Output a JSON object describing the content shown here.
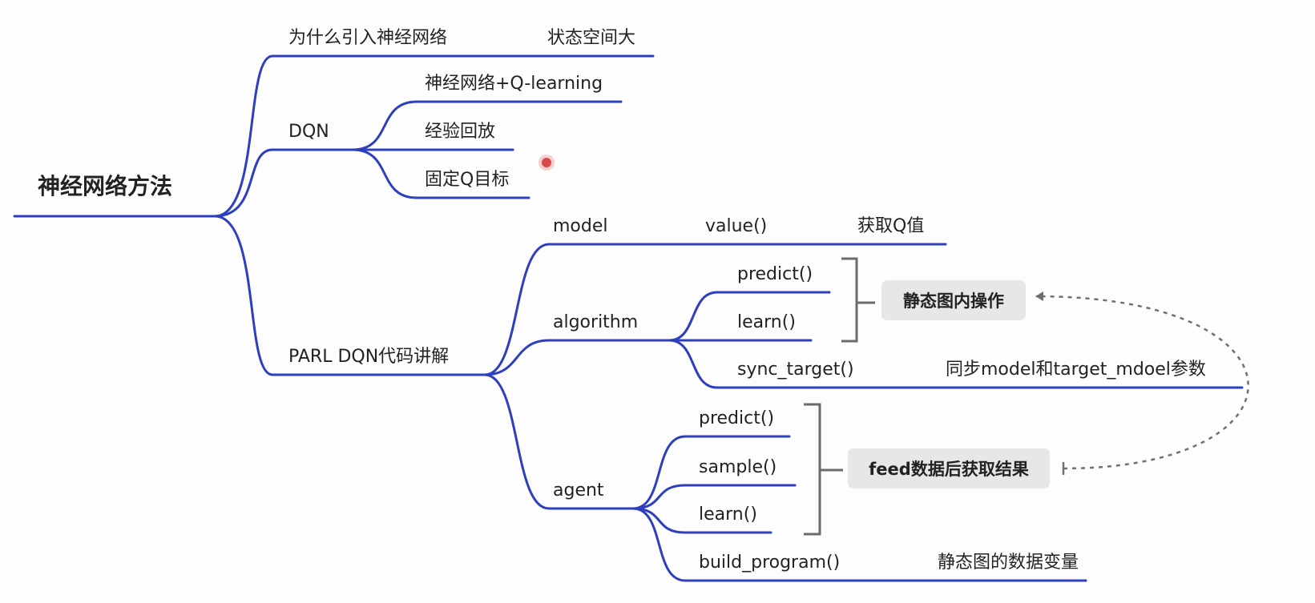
{
  "diagram": {
    "root": "神经网络方法",
    "why_nn": {
      "question": "为什么引入神经网络",
      "answer": "状态空间大"
    },
    "dqn": {
      "label": "DQN",
      "children": [
        "神经网络+Q-learning",
        "经验回放",
        "固定Q目标"
      ]
    },
    "parl": {
      "label": "PARL DQN代码讲解",
      "model": {
        "label": "model",
        "method": "value()",
        "desc": "获取Q值"
      },
      "algorithm": {
        "label": "algorithm",
        "predict": "predict()",
        "learn": "learn()",
        "sync": "sync_target()",
        "sync_desc": "同步model和target_mdoel参数",
        "callout": "静态图内操作"
      },
      "agent": {
        "label": "agent",
        "predict": "predict()",
        "sample": "sample()",
        "learn": "learn()",
        "build": "build_program()",
        "build_desc": "静态图的数据变量",
        "callout": "feed数据后获取结果"
      }
    }
  },
  "colors": {
    "branch": "#2d3fbf",
    "bracket": "#6b6b6b",
    "dashed_arrow": "#707070",
    "callout_bg": "#e7e7e7",
    "cursor": "#d84a4a"
  }
}
